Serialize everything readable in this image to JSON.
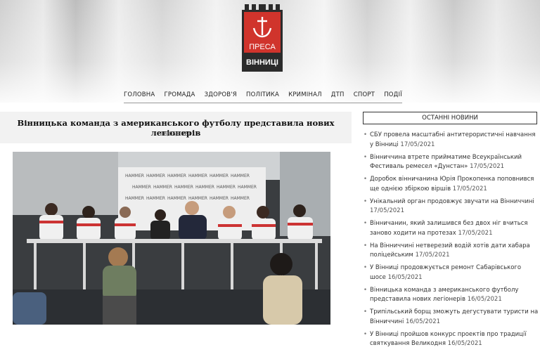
{
  "logo": {
    "line1": "ПРЕСА",
    "line2": "ВІННИЦІ"
  },
  "nav": [
    "ГОЛОВНА",
    "ГРОМАДА",
    "ЗДОРОВ'Я",
    "ПОЛІТИКА",
    "КРИМІНАЛ",
    "ДТП",
    "СПОРТ",
    "ПОДІЇ"
  ],
  "article": {
    "title": "Вінницька команда з американського футболу представила нових легіонерів",
    "date": "16/05/2021",
    "banner_text": "HAMMER"
  },
  "sidebar": {
    "heading": "ОСТАННІ НОВИНИ",
    "items": [
      {
        "text": "СБУ провела масштабні антитерористичні навчання у Вінниці",
        "date": "17/05/2021"
      },
      {
        "text": "Вінниччина втрете прийматиме Всеукраїнський Фестиваль ремесел «Дунстан»",
        "date": "17/05/2021"
      },
      {
        "text": "Доробок вінничанина Юрія Прокопенка поповнився ще однією збіркою віршів",
        "date": "17/05/2021"
      },
      {
        "text": "Унікальний орган продовжує звучати на Вінниччині",
        "date": "17/05/2021"
      },
      {
        "text": "Вінничанин, який залишився без двох ніг вчиться заново ходити на протезах",
        "date": "17/05/2021"
      },
      {
        "text": "На Вінниччині нетверезий водій хотів дати хабара поліцейським",
        "date": "17/05/2021"
      },
      {
        "text": "У Вінниці продовжується ремонт Сабарівського шосе",
        "date": "16/05/2021"
      },
      {
        "text": "Вінницька команда з американського футболу представила нових легіонерів",
        "date": "16/05/2021"
      },
      {
        "text": "Трипільський борщ зможуть дегустувати туристи на Вінниччині",
        "date": "16/05/2021"
      },
      {
        "text": "У Вінниці пройшов конкурс проектів про традиції святкування Великодня",
        "date": "16/05/2021"
      }
    ]
  },
  "colors": {
    "logo_red": "#d0342c",
    "logo_dark": "#2b2b2b"
  }
}
